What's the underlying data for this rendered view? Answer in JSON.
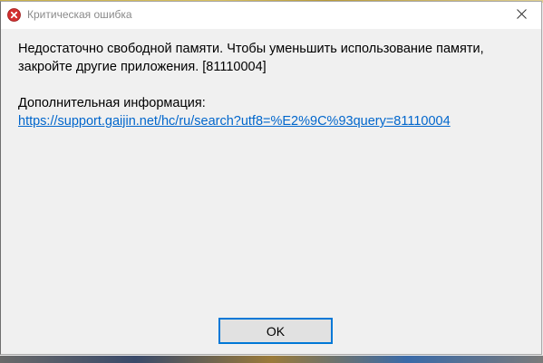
{
  "window": {
    "title": "Критическая ошибка",
    "title_icon": "error-icon",
    "close_icon": "close-icon"
  },
  "content": {
    "message": "Недостаточно свободной памяти. Чтобы уменьшить использование памяти, закройте другие приложения. [81110004]",
    "extra_label": "Дополнительная информация:",
    "link_text": "https://support.gaijin.net/hc/ru/search?utf8=%E2%9C%93query=81110004"
  },
  "buttons": {
    "ok_label": "OK"
  },
  "colors": {
    "link": "#0066cc",
    "error_icon": "#d32f2f",
    "button_focus_border": "#0078d7"
  }
}
